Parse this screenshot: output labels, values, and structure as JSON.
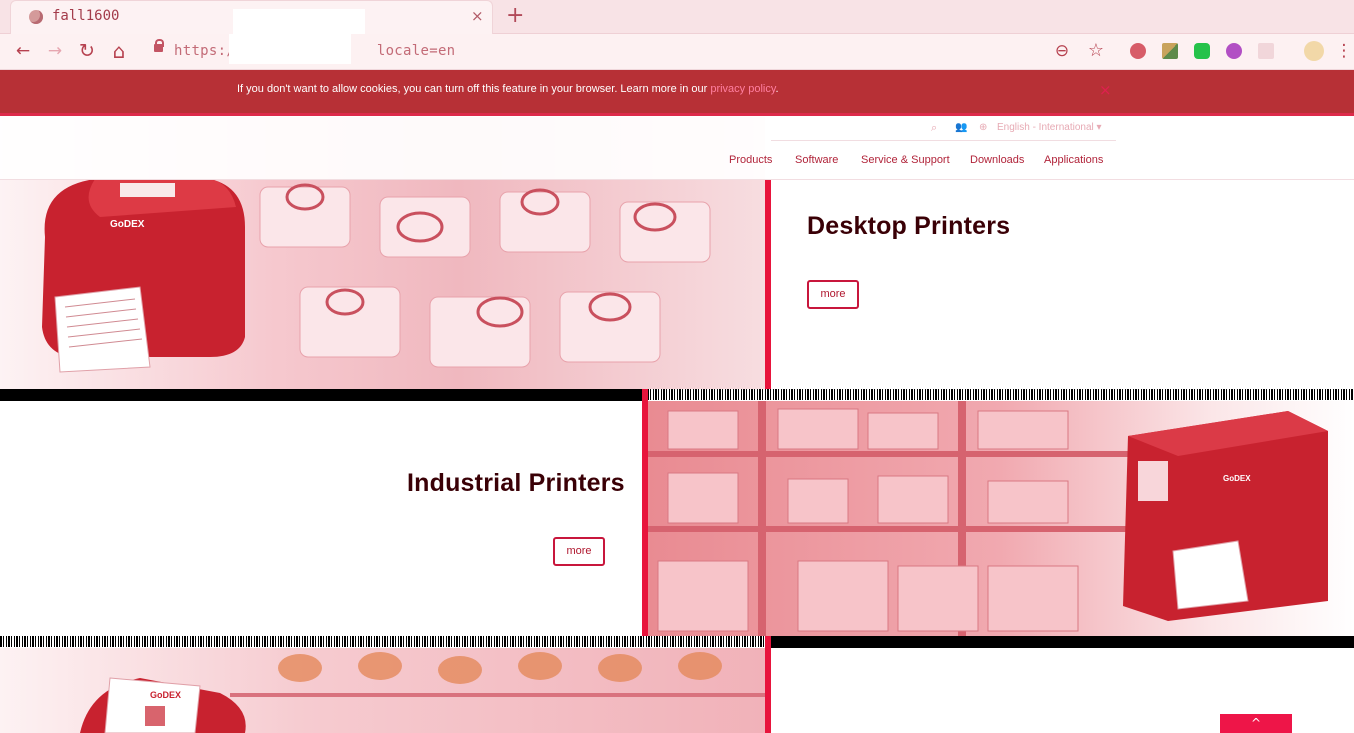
{
  "browser": {
    "tab_title": "fall1600",
    "tab_close": "×",
    "new_tab": "+",
    "url_prefix": "https://",
    "url_suffix": "locale=en",
    "back": "←",
    "forward": "→",
    "reload": "↻",
    "home": "⌂",
    "zoom": "⊖",
    "bookmark": "☆",
    "menu": "⋮"
  },
  "cookie_bar": {
    "text": "If you don't want to allow cookies, you can turn off this feature in your browser. Learn more in our ",
    "link": "privacy policy",
    "end": ".",
    "close": "×"
  },
  "header": {
    "language": "English - International",
    "caret": "▾",
    "nav": [
      "Products",
      "Software",
      "Service & Support",
      "Downloads",
      "Applications"
    ]
  },
  "sections": {
    "desktop": {
      "title": "Desktop Printers",
      "more": "more"
    },
    "industrial": {
      "title": "Industrial Printers",
      "more": "more"
    },
    "scroll_top": "^"
  },
  "colors": {
    "accent": "#e8143c",
    "cookie_bg": "#b73036",
    "heading": "#3a0006"
  }
}
